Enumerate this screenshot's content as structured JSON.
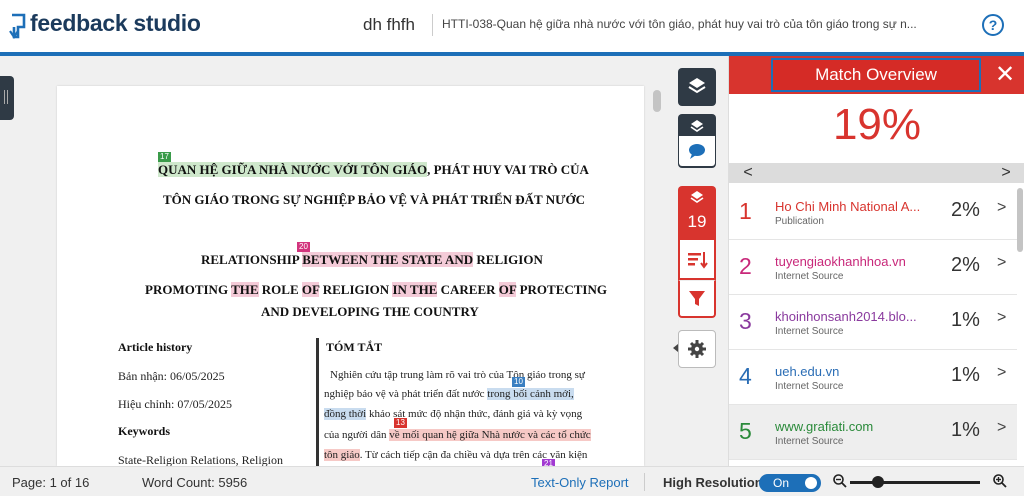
{
  "header": {
    "logo_text": "feedback studio",
    "author": "dh fhfh",
    "doc_title": "HTTI-038-Quan hệ giữa nhà nước với tôn giáo, phát huy vai trò của tôn giáo trong sự n...",
    "help": "?"
  },
  "doc": {
    "title_l1a": "QUAN HỆ GIỮA NHÀ NƯỚC VỚI TÔN GIÁO",
    "title_l1b": ", PHÁT HUY VAI TRÒ CỦA",
    "title_l2": "TÔN GIÁO TRONG SỰ NGHIỆP BẢO VỆ VÀ PHÁT TRIỂN ĐẤT NƯỚC",
    "en_l1a": "RELATIONSHIP ",
    "en_l1b": "BETWEEN THE STATE AND",
    "en_l1c": " RELIGION",
    "en_l2a": "PROMOTING ",
    "en_l2b": "THE",
    "en_l2c": " ROLE ",
    "en_l2d": "OF",
    "en_l2e": " RELIGION ",
    "en_l2f": "IN THE",
    "en_l2g": " CAREER ",
    "en_l2h": "OF",
    "en_l2i": " PROTECTING",
    "en_l3": "AND DEVELOPING THE COUNTRY",
    "article_history": "Article history",
    "received": "Bản nhận: 06/05/2025",
    "revised": "Hiệu chỉnh: 07/05/2025",
    "keywords": "Keywords",
    "keywords_val": "State-Religion   Relations,   Religion",
    "abstract_title": "TÓM TẮT",
    "abs_l1": "Nghiên cứu tập trung làm rõ vai trò của Tôn giáo trong sự",
    "abs_l2a": "nghiệp bảo vệ và phát triển đất nước ",
    "abs_l2b": "trong bối cảnh mới,",
    "abs_l3a": "đồng thời",
    "abs_l3b": " khảo sát mức độ nhận thức, đánh giá và kỳ vọng",
    "abs_l4a": "của người dân ",
    "abs_l4b": "về mối quan hệ giữa Nhà nước và các tổ chức",
    "abs_l5a": "tôn giáo",
    "abs_l5b": ". Từ cách tiếp cận đa chiều và dựa trên các văn kiện",
    "tags": {
      "t17": "17",
      "t20": "20",
      "t10": "10",
      "t13": "13",
      "t21": "21"
    }
  },
  "toolbar": {
    "match_count": "19"
  },
  "panel": {
    "title": "Match Overview",
    "close": "✕",
    "percent": "19%",
    "prev": "<",
    "next": ">",
    "matches": [
      {
        "num": "1",
        "name": "Ho Chi Minh National A...",
        "type": "Publication",
        "pct": "2%",
        "color": "#d8342e"
      },
      {
        "num": "2",
        "name": "tuyengiaokhanhhoa.vn",
        "type": "Internet Source",
        "pct": "2%",
        "color": "#c8287a"
      },
      {
        "num": "3",
        "name": "khoinhonsanh2014.blo...",
        "type": "Internet Source",
        "pct": "1%",
        "color": "#8a3a9e"
      },
      {
        "num": "4",
        "name": "ueh.edu.vn",
        "type": "Internet Source",
        "pct": "1%",
        "color": "#2a6db5"
      },
      {
        "num": "5",
        "name": "www.grafiati.com",
        "type": "Internet Source",
        "pct": "1%",
        "color": "#2a8a3a"
      }
    ]
  },
  "footer": {
    "page": "Page: 1 of 16",
    "word_count": "Word Count: 5956",
    "text_only": "Text-Only Report",
    "high_res": "High Resolution",
    "toggle": "On"
  },
  "colors": {
    "brand_blue": "#1d6fb8",
    "match_red": "#d8342e",
    "toolbar_dark": "#2f3a45"
  }
}
